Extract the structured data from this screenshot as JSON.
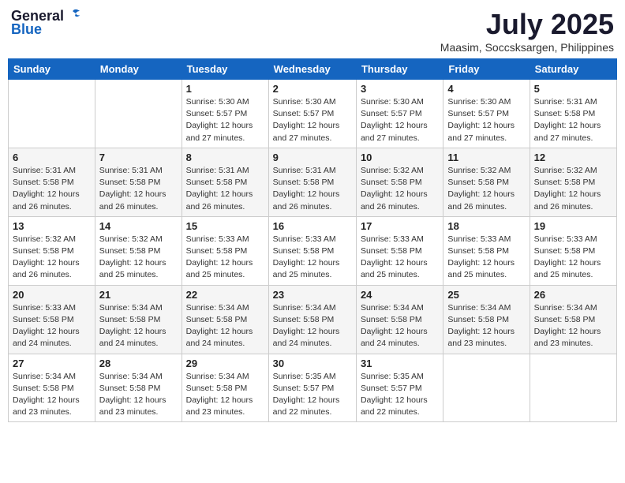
{
  "header": {
    "logo_general": "General",
    "logo_blue": "Blue",
    "month": "July 2025",
    "location": "Maasim, Soccsksargen, Philippines"
  },
  "weekdays": [
    "Sunday",
    "Monday",
    "Tuesday",
    "Wednesday",
    "Thursday",
    "Friday",
    "Saturday"
  ],
  "weeks": [
    [
      {
        "day": "",
        "sunrise": "",
        "sunset": "",
        "daylight": ""
      },
      {
        "day": "",
        "sunrise": "",
        "sunset": "",
        "daylight": ""
      },
      {
        "day": "1",
        "sunrise": "Sunrise: 5:30 AM",
        "sunset": "Sunset: 5:57 PM",
        "daylight": "Daylight: 12 hours and 27 minutes."
      },
      {
        "day": "2",
        "sunrise": "Sunrise: 5:30 AM",
        "sunset": "Sunset: 5:57 PM",
        "daylight": "Daylight: 12 hours and 27 minutes."
      },
      {
        "day": "3",
        "sunrise": "Sunrise: 5:30 AM",
        "sunset": "Sunset: 5:57 PM",
        "daylight": "Daylight: 12 hours and 27 minutes."
      },
      {
        "day": "4",
        "sunrise": "Sunrise: 5:30 AM",
        "sunset": "Sunset: 5:57 PM",
        "daylight": "Daylight: 12 hours and 27 minutes."
      },
      {
        "day": "5",
        "sunrise": "Sunrise: 5:31 AM",
        "sunset": "Sunset: 5:58 PM",
        "daylight": "Daylight: 12 hours and 27 minutes."
      }
    ],
    [
      {
        "day": "6",
        "sunrise": "Sunrise: 5:31 AM",
        "sunset": "Sunset: 5:58 PM",
        "daylight": "Daylight: 12 hours and 26 minutes."
      },
      {
        "day": "7",
        "sunrise": "Sunrise: 5:31 AM",
        "sunset": "Sunset: 5:58 PM",
        "daylight": "Daylight: 12 hours and 26 minutes."
      },
      {
        "day": "8",
        "sunrise": "Sunrise: 5:31 AM",
        "sunset": "Sunset: 5:58 PM",
        "daylight": "Daylight: 12 hours and 26 minutes."
      },
      {
        "day": "9",
        "sunrise": "Sunrise: 5:31 AM",
        "sunset": "Sunset: 5:58 PM",
        "daylight": "Daylight: 12 hours and 26 minutes."
      },
      {
        "day": "10",
        "sunrise": "Sunrise: 5:32 AM",
        "sunset": "Sunset: 5:58 PM",
        "daylight": "Daylight: 12 hours and 26 minutes."
      },
      {
        "day": "11",
        "sunrise": "Sunrise: 5:32 AM",
        "sunset": "Sunset: 5:58 PM",
        "daylight": "Daylight: 12 hours and 26 minutes."
      },
      {
        "day": "12",
        "sunrise": "Sunrise: 5:32 AM",
        "sunset": "Sunset: 5:58 PM",
        "daylight": "Daylight: 12 hours and 26 minutes."
      }
    ],
    [
      {
        "day": "13",
        "sunrise": "Sunrise: 5:32 AM",
        "sunset": "Sunset: 5:58 PM",
        "daylight": "Daylight: 12 hours and 26 minutes."
      },
      {
        "day": "14",
        "sunrise": "Sunrise: 5:32 AM",
        "sunset": "Sunset: 5:58 PM",
        "daylight": "Daylight: 12 hours and 25 minutes."
      },
      {
        "day": "15",
        "sunrise": "Sunrise: 5:33 AM",
        "sunset": "Sunset: 5:58 PM",
        "daylight": "Daylight: 12 hours and 25 minutes."
      },
      {
        "day": "16",
        "sunrise": "Sunrise: 5:33 AM",
        "sunset": "Sunset: 5:58 PM",
        "daylight": "Daylight: 12 hours and 25 minutes."
      },
      {
        "day": "17",
        "sunrise": "Sunrise: 5:33 AM",
        "sunset": "Sunset: 5:58 PM",
        "daylight": "Daylight: 12 hours and 25 minutes."
      },
      {
        "day": "18",
        "sunrise": "Sunrise: 5:33 AM",
        "sunset": "Sunset: 5:58 PM",
        "daylight": "Daylight: 12 hours and 25 minutes."
      },
      {
        "day": "19",
        "sunrise": "Sunrise: 5:33 AM",
        "sunset": "Sunset: 5:58 PM",
        "daylight": "Daylight: 12 hours and 25 minutes."
      }
    ],
    [
      {
        "day": "20",
        "sunrise": "Sunrise: 5:33 AM",
        "sunset": "Sunset: 5:58 PM",
        "daylight": "Daylight: 12 hours and 24 minutes."
      },
      {
        "day": "21",
        "sunrise": "Sunrise: 5:34 AM",
        "sunset": "Sunset: 5:58 PM",
        "daylight": "Daylight: 12 hours and 24 minutes."
      },
      {
        "day": "22",
        "sunrise": "Sunrise: 5:34 AM",
        "sunset": "Sunset: 5:58 PM",
        "daylight": "Daylight: 12 hours and 24 minutes."
      },
      {
        "day": "23",
        "sunrise": "Sunrise: 5:34 AM",
        "sunset": "Sunset: 5:58 PM",
        "daylight": "Daylight: 12 hours and 24 minutes."
      },
      {
        "day": "24",
        "sunrise": "Sunrise: 5:34 AM",
        "sunset": "Sunset: 5:58 PM",
        "daylight": "Daylight: 12 hours and 24 minutes."
      },
      {
        "day": "25",
        "sunrise": "Sunrise: 5:34 AM",
        "sunset": "Sunset: 5:58 PM",
        "daylight": "Daylight: 12 hours and 23 minutes."
      },
      {
        "day": "26",
        "sunrise": "Sunrise: 5:34 AM",
        "sunset": "Sunset: 5:58 PM",
        "daylight": "Daylight: 12 hours and 23 minutes."
      }
    ],
    [
      {
        "day": "27",
        "sunrise": "Sunrise: 5:34 AM",
        "sunset": "Sunset: 5:58 PM",
        "daylight": "Daylight: 12 hours and 23 minutes."
      },
      {
        "day": "28",
        "sunrise": "Sunrise: 5:34 AM",
        "sunset": "Sunset: 5:58 PM",
        "daylight": "Daylight: 12 hours and 23 minutes."
      },
      {
        "day": "29",
        "sunrise": "Sunrise: 5:34 AM",
        "sunset": "Sunset: 5:58 PM",
        "daylight": "Daylight: 12 hours and 23 minutes."
      },
      {
        "day": "30",
        "sunrise": "Sunrise: 5:35 AM",
        "sunset": "Sunset: 5:57 PM",
        "daylight": "Daylight: 12 hours and 22 minutes."
      },
      {
        "day": "31",
        "sunrise": "Sunrise: 5:35 AM",
        "sunset": "Sunset: 5:57 PM",
        "daylight": "Daylight: 12 hours and 22 minutes."
      },
      {
        "day": "",
        "sunrise": "",
        "sunset": "",
        "daylight": ""
      },
      {
        "day": "",
        "sunrise": "",
        "sunset": "",
        "daylight": ""
      }
    ]
  ]
}
